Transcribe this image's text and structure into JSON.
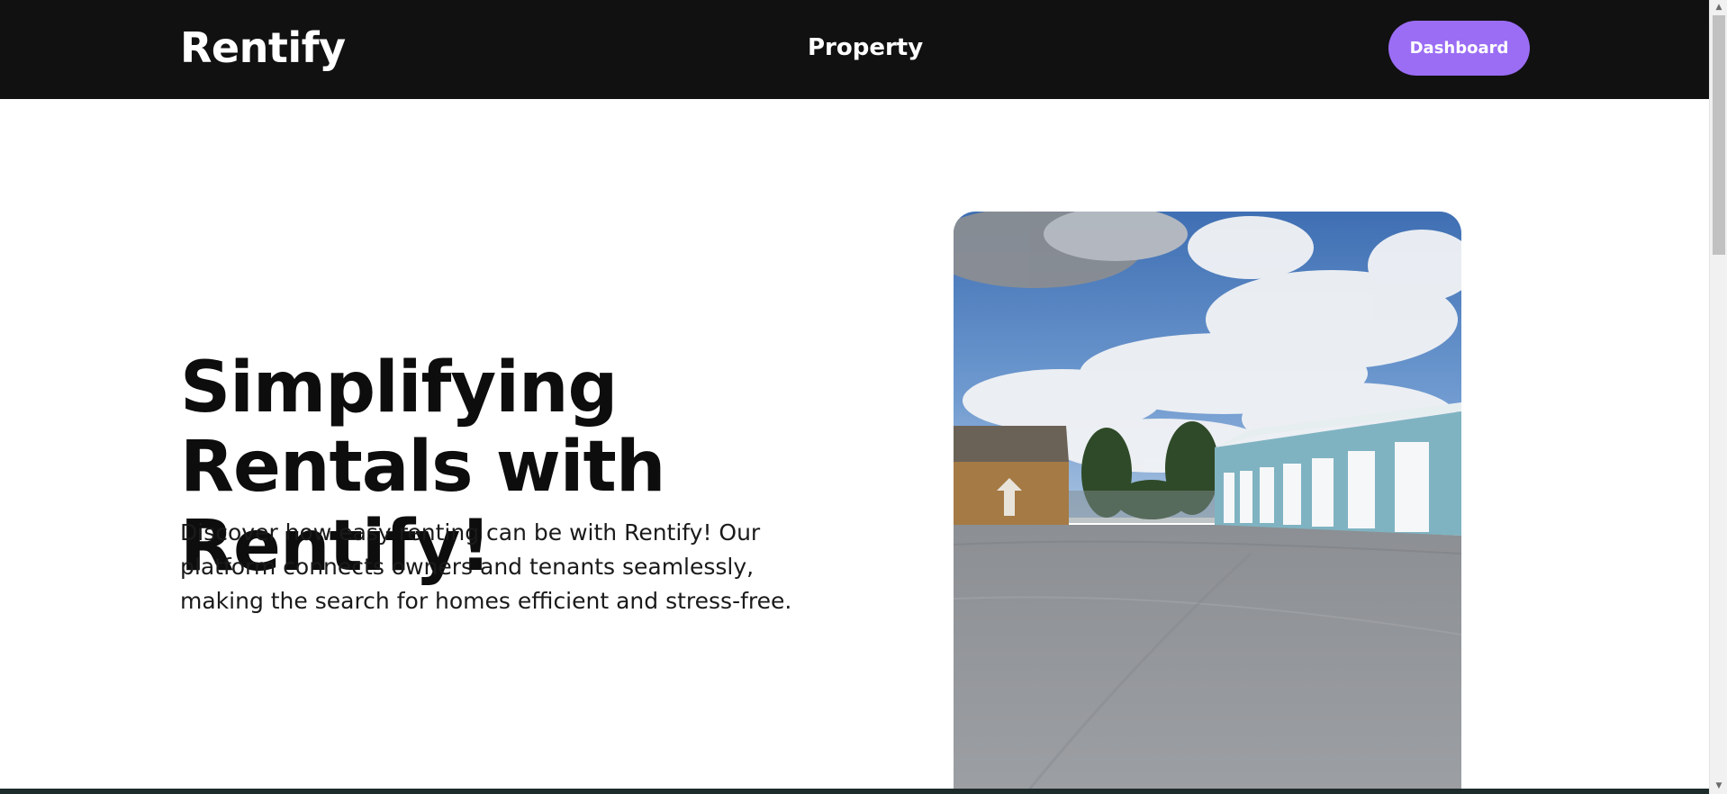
{
  "navbar": {
    "brand": "Rentify",
    "links": [
      {
        "label": "Property"
      }
    ],
    "dashboard_button": "Dashboard"
  },
  "hero": {
    "title": "Simplifying Rentals with Rentify!",
    "description": "Discover how easy renting can be with Rentify! Our platform connects owners and tenants seamlessly, making the search for homes efficient and stress-free."
  },
  "colors": {
    "navbar_bg": "#111111",
    "accent": "#9b6df5",
    "text": "#0d0d0d"
  },
  "icons": {
    "scroll_up": "scroll-up-arrow-icon",
    "scroll_down": "scroll-down-arrow-icon"
  }
}
